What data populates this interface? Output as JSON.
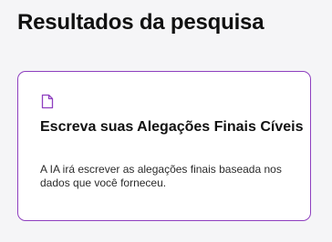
{
  "header": {
    "title": "Resultados da pesquisa"
  },
  "results": [
    {
      "icon": "document-icon",
      "title": "Escreva suas Alegações Finais Cíveis",
      "description": "A IA irá escrever as alegações finais baseada nos dados que você forneceu."
    }
  ],
  "colors": {
    "accent": "#8e3fbf",
    "background": "#f5f5f7",
    "card": "#ffffff",
    "text": "#111111"
  }
}
